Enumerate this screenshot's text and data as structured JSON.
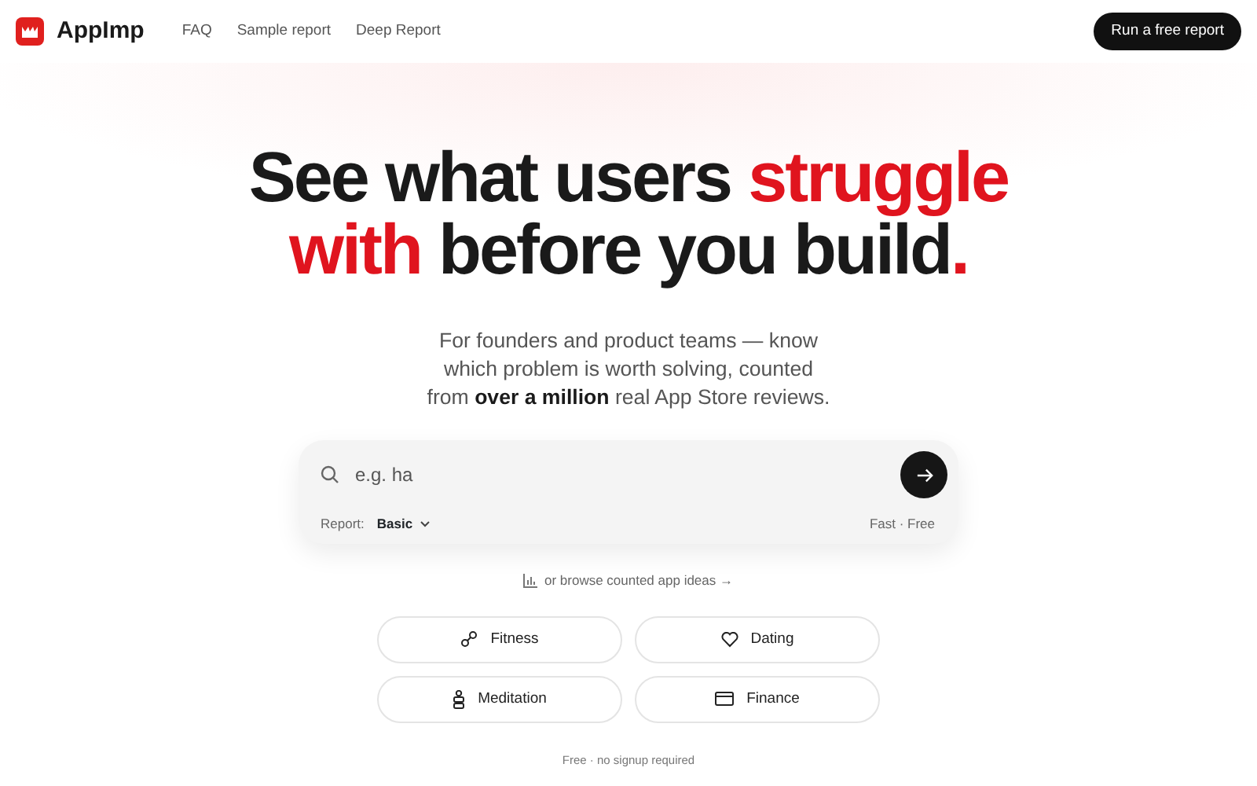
{
  "brand": "AppImp",
  "nav": [
    "FAQ",
    "Sample report",
    "Deep Report"
  ],
  "cta": "Run a free report",
  "headline": [
    {
      "text": "See what users ",
      "accent": false
    },
    {
      "text": "struggle",
      "accent": true
    },
    {
      "text": "with",
      "accent": true
    },
    {
      "text": " before you build",
      "accent": false
    },
    {
      "text": ".",
      "accent": true
    }
  ],
  "subtitle": "For founders and product teams — know which problem is worth solving, counted from **over a million** real App Store reviews.",
  "search": {
    "value": "e.g. ha",
    "report_label": "Report:",
    "report_value": "Basic",
    "note": "Fast · Free"
  },
  "browse_link": "or browse counted app ideas →",
  "categories": [
    "Fitness",
    "Dating",
    "Meditation",
    "Finance"
  ],
  "footnote": "Free · no signup required"
}
